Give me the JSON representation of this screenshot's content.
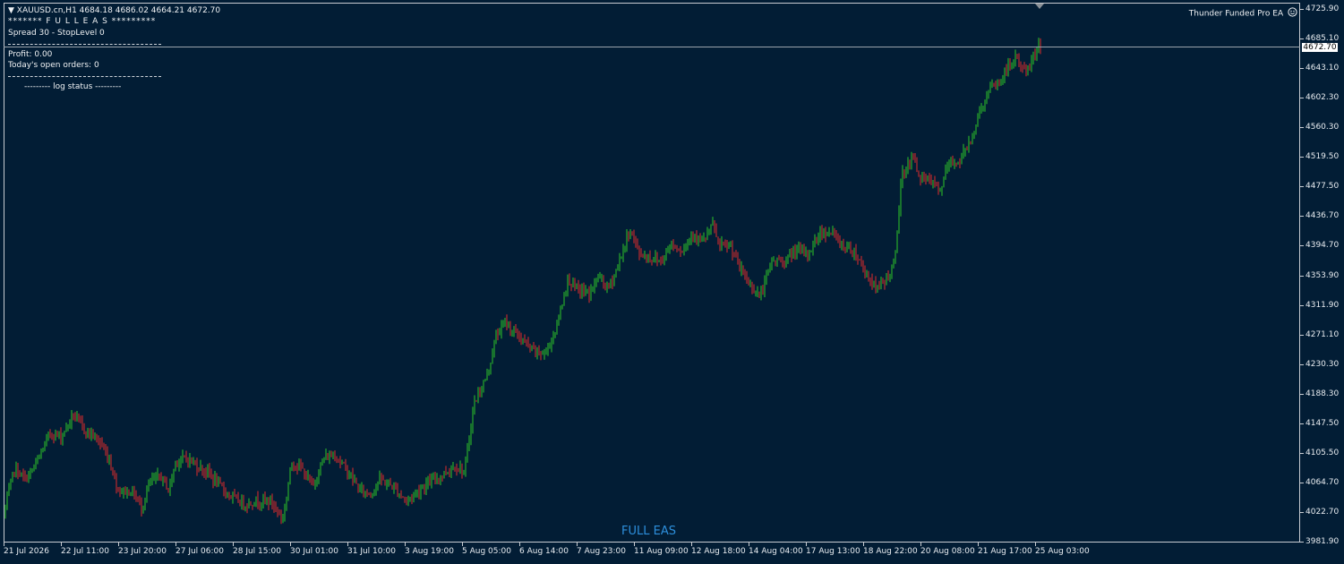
{
  "chart_header": {
    "symbol_line": "▼ XAUUSD.cn,H1  4684.18 4686.02 4664.21 4672.70",
    "banner": "******* F U L L   E A S *********",
    "spread_line": "Spread 30 - StopLevel 0",
    "profit_line": "Profit: 0.00",
    "open_orders_line": "Today's open orders: 0",
    "log_status": "--------- log status ---------"
  },
  "ea_name": "Thunder Funded Pro EA",
  "watermark": "FULL EAS",
  "current_price_label": "4672.70",
  "colors": {
    "background": "#021d35",
    "bull_candle": "#2ec828",
    "bear_candle": "#e02c2c",
    "axis_text": "#e8ecf0",
    "watermark": "#2d8fdc"
  },
  "chart_data": {
    "type": "candlestick",
    "symbol": "XAUUSD.cn",
    "timeframe": "H1",
    "last_bar": {
      "open": 4684.18,
      "high": 4686.02,
      "low": 4664.21,
      "close": 4672.7
    },
    "current_price": 4672.7,
    "ylim": [
      3981.9,
      4725.9
    ],
    "yticks": [
      "4725.90",
      "4685.10",
      "4643.10",
      "4602.30",
      "4560.30",
      "4519.50",
      "4477.50",
      "4436.70",
      "4394.70",
      "4353.90",
      "4311.90",
      "4271.10",
      "4230.30",
      "4188.30",
      "4147.50",
      "4105.50",
      "4064.70",
      "4022.70",
      "3981.90"
    ],
    "xticks": [
      "21 Jul 2026",
      "22 Jul 11:00",
      "23 Jul 20:00",
      "27 Jul 06:00",
      "28 Jul 15:00",
      "30 Jul 01:00",
      "31 Jul 10:00",
      "3 Aug 19:00",
      "5 Aug 05:00",
      "6 Aug 14:00",
      "7 Aug 23:00",
      "11 Aug 09:00",
      "12 Aug 18:00",
      "14 Aug 04:00",
      "17 Aug 13:00",
      "18 Aug 22:00",
      "20 Aug 08:00",
      "21 Aug 17:00",
      "25 Aug 03:00"
    ],
    "price_path": [
      [
        0,
        4020
      ],
      [
        12,
        4085
      ],
      [
        24,
        4070
      ],
      [
        35,
        4088
      ],
      [
        52,
        4135
      ],
      [
        64,
        4130
      ],
      [
        78,
        4160
      ],
      [
        90,
        4140
      ],
      [
        106,
        4125
      ],
      [
        118,
        4098
      ],
      [
        128,
        4055
      ],
      [
        145,
        4052
      ],
      [
        154,
        4030
      ],
      [
        163,
        4065
      ],
      [
        175,
        4075
      ],
      [
        185,
        4055
      ],
      [
        192,
        4095
      ],
      [
        205,
        4100
      ],
      [
        215,
        4090
      ],
      [
        228,
        4080
      ],
      [
        242,
        4060
      ],
      [
        255,
        4045
      ],
      [
        270,
        4035
      ],
      [
        282,
        4040
      ],
      [
        298,
        4040
      ],
      [
        312,
        4015
      ],
      [
        322,
        4095
      ],
      [
        333,
        4085
      ],
      [
        345,
        4060
      ],
      [
        358,
        4100
      ],
      [
        370,
        4105
      ],
      [
        385,
        4080
      ],
      [
        398,
        4055
      ],
      [
        410,
        4050
      ],
      [
        420,
        4070
      ],
      [
        435,
        4060
      ],
      [
        450,
        4040
      ],
      [
        468,
        4060
      ],
      [
        488,
        4075
      ],
      [
        505,
        4090
      ],
      [
        515,
        4080
      ],
      [
        525,
        4175
      ],
      [
        540,
        4215
      ],
      [
        550,
        4270
      ],
      [
        560,
        4290
      ],
      [
        575,
        4270
      ],
      [
        590,
        4250
      ],
      [
        605,
        4245
      ],
      [
        618,
        4285
      ],
      [
        630,
        4350
      ],
      [
        640,
        4335
      ],
      [
        655,
        4330
      ],
      [
        665,
        4355
      ],
      [
        675,
        4335
      ],
      [
        685,
        4365
      ],
      [
        700,
        4420
      ],
      [
        710,
        4385
      ],
      [
        722,
        4380
      ],
      [
        735,
        4375
      ],
      [
        745,
        4400
      ],
      [
        758,
        4390
      ],
      [
        770,
        4415
      ],
      [
        780,
        4400
      ],
      [
        792,
        4425
      ],
      [
        800,
        4395
      ],
      [
        812,
        4395
      ],
      [
        822,
        4365
      ],
      [
        832,
        4345
      ],
      [
        845,
        4325
      ],
      [
        858,
        4375
      ],
      [
        872,
        4375
      ],
      [
        885,
        4390
      ],
      [
        898,
        4385
      ],
      [
        912,
        4415
      ],
      [
        925,
        4415
      ],
      [
        938,
        4395
      ],
      [
        950,
        4390
      ],
      [
        960,
        4365
      ],
      [
        975,
        4335
      ],
      [
        985,
        4350
      ],
      [
        995,
        4370
      ],
      [
        1003,
        4495
      ],
      [
        1015,
        4520
      ],
      [
        1025,
        4490
      ],
      [
        1038,
        4485
      ],
      [
        1045,
        4470
      ],
      [
        1055,
        4510
      ],
      [
        1068,
        4515
      ],
      [
        1080,
        4545
      ],
      [
        1092,
        4590
      ],
      [
        1102,
        4615
      ],
      [
        1112,
        4625
      ],
      [
        1122,
        4645
      ],
      [
        1132,
        4660
      ],
      [
        1140,
        4640
      ],
      [
        1148,
        4650
      ],
      [
        1156,
        4684
      ],
      [
        1158,
        4672.7
      ]
    ]
  }
}
